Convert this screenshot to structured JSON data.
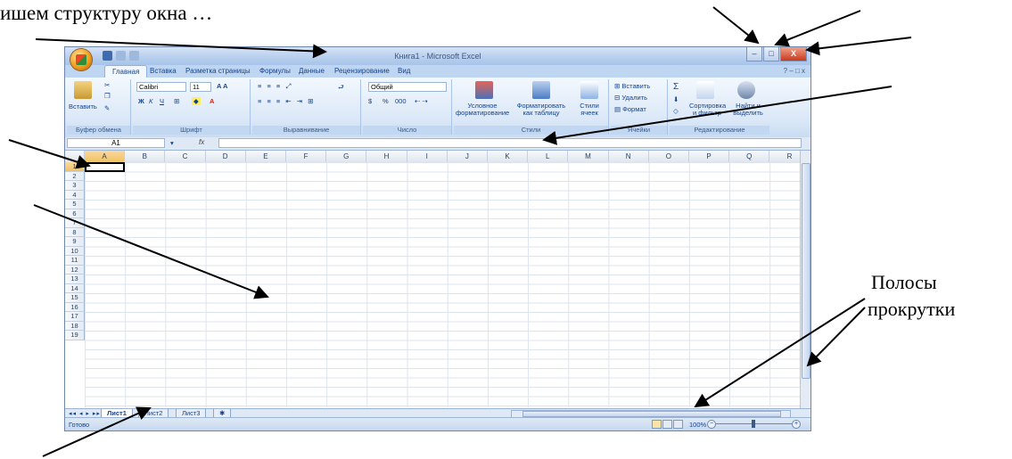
{
  "captions": {
    "top": "ишем структуру окна …",
    "scrollbars_line1": "Полосы",
    "scrollbars_line2": "прокрутки"
  },
  "window": {
    "title": "Книга1 - Microsoft Excel",
    "controls": {
      "minimize": "–",
      "maximize": "□",
      "close": "X"
    }
  },
  "ribbon_tabs": [
    "Главная",
    "Вставка",
    "Разметка страницы",
    "Формулы",
    "Данные",
    "Рецензирование",
    "Вид"
  ],
  "ribbon": {
    "clipboard": {
      "paste": "Вставить",
      "label": "Буфер обмена"
    },
    "font": {
      "name": "Calibri",
      "size": "11",
      "bold": "Ж",
      "italic": "К",
      "underline": "Ч",
      "label": "Шрифт"
    },
    "alignment": {
      "label": "Выравнивание"
    },
    "number": {
      "format": "Общий",
      "percent": "%",
      "thousands": "000",
      "label": "Число"
    },
    "styles": {
      "conditional": "Условное форматирование",
      "as_table": "Форматировать как таблицу",
      "cell_styles": "Стили ячеек",
      "label": "Стили"
    },
    "cells": {
      "insert": "Вставить",
      "delete": "Удалить",
      "format": "Формат",
      "label": "Ячейки"
    },
    "editing": {
      "sum": "Σ",
      "sort": "Сортировка и фильтр",
      "find": "Найти и выделить",
      "label": "Редактирование"
    }
  },
  "formula_bar": {
    "name_box": "A1",
    "fx": "fx"
  },
  "columns": [
    "A",
    "B",
    "C",
    "D",
    "E",
    "F",
    "G",
    "H",
    "I",
    "J",
    "K",
    "L",
    "M",
    "N",
    "O",
    "P",
    "Q",
    "R"
  ],
  "rows": [
    "1",
    "2",
    "3",
    "4",
    "5",
    "6",
    "7",
    "8",
    "9",
    "10",
    "11",
    "12",
    "13",
    "14",
    "15",
    "16",
    "17",
    "18",
    "19"
  ],
  "sheet_nav": "◂◂ ◂ ▸ ▸▸",
  "sheets": [
    "Лист1",
    "Лист2",
    "Лист3"
  ],
  "status": {
    "ready": "Готово",
    "zoom": "100%"
  },
  "colors": {
    "accent": "#15428b",
    "ribbon_bg": "#dbe8f7",
    "close": "#c9391b"
  }
}
